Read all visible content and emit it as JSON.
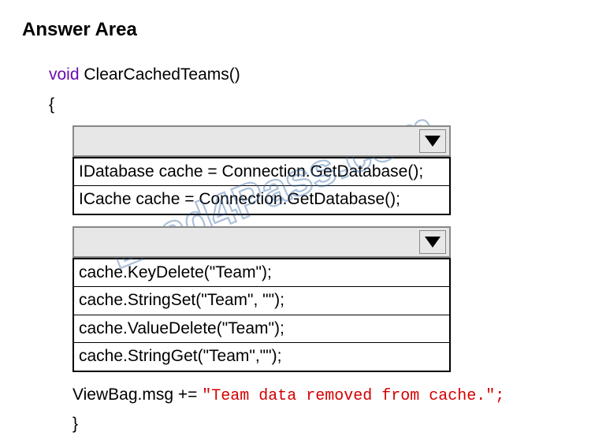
{
  "heading": "Answer Area",
  "code": {
    "void_kw": "void",
    "fn_decl": " ClearCachedTeams()",
    "open_brace": "{",
    "close_brace": "}",
    "viewbag_prefix": "ViewBag.msg += ",
    "viewbag_str": "\"Team data removed from cache.\";"
  },
  "dropdown1": {
    "options": [
      "IDatabase cache = Connection.GetDatabase();",
      "ICache cache = Connection.GetDatabase();"
    ]
  },
  "dropdown2": {
    "options": [
      "cache.KeyDelete(\"Team\");",
      "cache.StringSet(\"Team\", \"\");",
      "cache.ValueDelete(\"Team\");",
      "cache.StringGet(\"Team\",\"\");"
    ]
  },
  "watermark": "Lead4Pass.com"
}
